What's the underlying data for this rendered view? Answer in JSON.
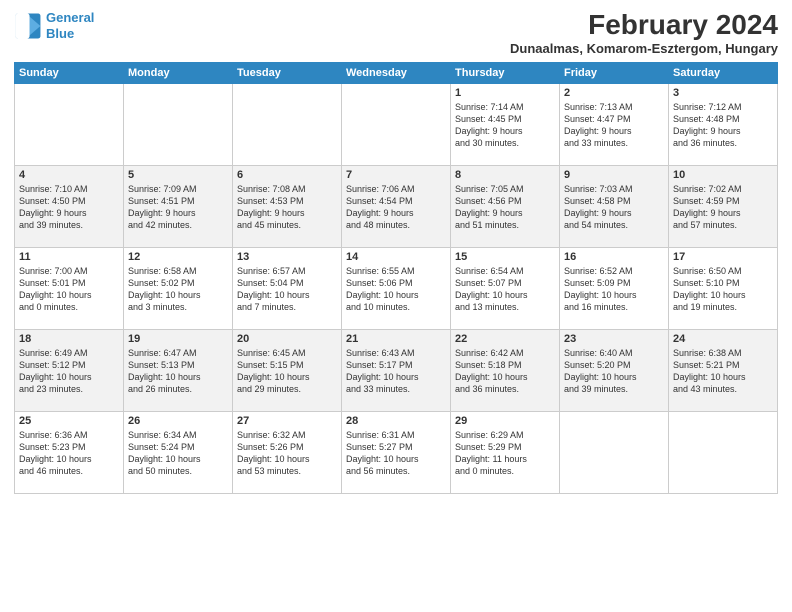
{
  "logo": {
    "line1": "General",
    "line2": "Blue"
  },
  "title": "February 2024",
  "subtitle": "Dunaalmas, Komarom-Esztergom, Hungary",
  "days_of_week": [
    "Sunday",
    "Monday",
    "Tuesday",
    "Wednesday",
    "Thursday",
    "Friday",
    "Saturday"
  ],
  "weeks": [
    [
      {
        "day": "",
        "info": ""
      },
      {
        "day": "",
        "info": ""
      },
      {
        "day": "",
        "info": ""
      },
      {
        "day": "",
        "info": ""
      },
      {
        "day": "1",
        "info": "Sunrise: 7:14 AM\nSunset: 4:45 PM\nDaylight: 9 hours\nand 30 minutes."
      },
      {
        "day": "2",
        "info": "Sunrise: 7:13 AM\nSunset: 4:47 PM\nDaylight: 9 hours\nand 33 minutes."
      },
      {
        "day": "3",
        "info": "Sunrise: 7:12 AM\nSunset: 4:48 PM\nDaylight: 9 hours\nand 36 minutes."
      }
    ],
    [
      {
        "day": "4",
        "info": "Sunrise: 7:10 AM\nSunset: 4:50 PM\nDaylight: 9 hours\nand 39 minutes."
      },
      {
        "day": "5",
        "info": "Sunrise: 7:09 AM\nSunset: 4:51 PM\nDaylight: 9 hours\nand 42 minutes."
      },
      {
        "day": "6",
        "info": "Sunrise: 7:08 AM\nSunset: 4:53 PM\nDaylight: 9 hours\nand 45 minutes."
      },
      {
        "day": "7",
        "info": "Sunrise: 7:06 AM\nSunset: 4:54 PM\nDaylight: 9 hours\nand 48 minutes."
      },
      {
        "day": "8",
        "info": "Sunrise: 7:05 AM\nSunset: 4:56 PM\nDaylight: 9 hours\nand 51 minutes."
      },
      {
        "day": "9",
        "info": "Sunrise: 7:03 AM\nSunset: 4:58 PM\nDaylight: 9 hours\nand 54 minutes."
      },
      {
        "day": "10",
        "info": "Sunrise: 7:02 AM\nSunset: 4:59 PM\nDaylight: 9 hours\nand 57 minutes."
      }
    ],
    [
      {
        "day": "11",
        "info": "Sunrise: 7:00 AM\nSunset: 5:01 PM\nDaylight: 10 hours\nand 0 minutes."
      },
      {
        "day": "12",
        "info": "Sunrise: 6:58 AM\nSunset: 5:02 PM\nDaylight: 10 hours\nand 3 minutes."
      },
      {
        "day": "13",
        "info": "Sunrise: 6:57 AM\nSunset: 5:04 PM\nDaylight: 10 hours\nand 7 minutes."
      },
      {
        "day": "14",
        "info": "Sunrise: 6:55 AM\nSunset: 5:06 PM\nDaylight: 10 hours\nand 10 minutes."
      },
      {
        "day": "15",
        "info": "Sunrise: 6:54 AM\nSunset: 5:07 PM\nDaylight: 10 hours\nand 13 minutes."
      },
      {
        "day": "16",
        "info": "Sunrise: 6:52 AM\nSunset: 5:09 PM\nDaylight: 10 hours\nand 16 minutes."
      },
      {
        "day": "17",
        "info": "Sunrise: 6:50 AM\nSunset: 5:10 PM\nDaylight: 10 hours\nand 19 minutes."
      }
    ],
    [
      {
        "day": "18",
        "info": "Sunrise: 6:49 AM\nSunset: 5:12 PM\nDaylight: 10 hours\nand 23 minutes."
      },
      {
        "day": "19",
        "info": "Sunrise: 6:47 AM\nSunset: 5:13 PM\nDaylight: 10 hours\nand 26 minutes."
      },
      {
        "day": "20",
        "info": "Sunrise: 6:45 AM\nSunset: 5:15 PM\nDaylight: 10 hours\nand 29 minutes."
      },
      {
        "day": "21",
        "info": "Sunrise: 6:43 AM\nSunset: 5:17 PM\nDaylight: 10 hours\nand 33 minutes."
      },
      {
        "day": "22",
        "info": "Sunrise: 6:42 AM\nSunset: 5:18 PM\nDaylight: 10 hours\nand 36 minutes."
      },
      {
        "day": "23",
        "info": "Sunrise: 6:40 AM\nSunset: 5:20 PM\nDaylight: 10 hours\nand 39 minutes."
      },
      {
        "day": "24",
        "info": "Sunrise: 6:38 AM\nSunset: 5:21 PM\nDaylight: 10 hours\nand 43 minutes."
      }
    ],
    [
      {
        "day": "25",
        "info": "Sunrise: 6:36 AM\nSunset: 5:23 PM\nDaylight: 10 hours\nand 46 minutes."
      },
      {
        "day": "26",
        "info": "Sunrise: 6:34 AM\nSunset: 5:24 PM\nDaylight: 10 hours\nand 50 minutes."
      },
      {
        "day": "27",
        "info": "Sunrise: 6:32 AM\nSunset: 5:26 PM\nDaylight: 10 hours\nand 53 minutes."
      },
      {
        "day": "28",
        "info": "Sunrise: 6:31 AM\nSunset: 5:27 PM\nDaylight: 10 hours\nand 56 minutes."
      },
      {
        "day": "29",
        "info": "Sunrise: 6:29 AM\nSunset: 5:29 PM\nDaylight: 11 hours\nand 0 minutes."
      },
      {
        "day": "",
        "info": ""
      },
      {
        "day": "",
        "info": ""
      }
    ]
  ]
}
